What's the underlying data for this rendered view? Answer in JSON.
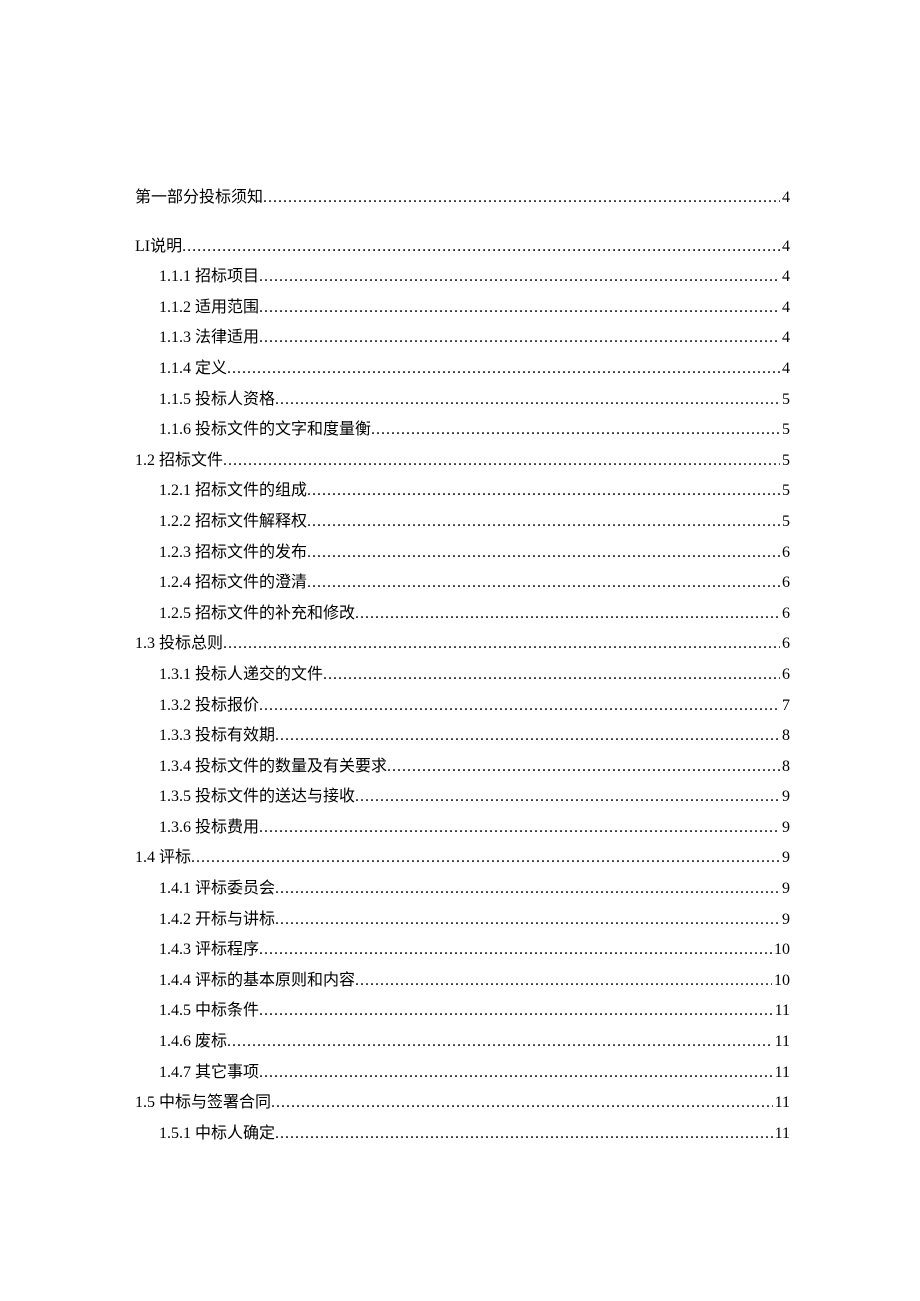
{
  "toc": [
    {
      "indent": 0,
      "title": "第一部分投标须知",
      "page": "4",
      "spacer_after": true
    },
    {
      "indent": 0,
      "title": "LI说明",
      "page": "4"
    },
    {
      "indent": 1,
      "title": "1.1.1 招标项目",
      "page": "4"
    },
    {
      "indent": 1,
      "title": "1.1.2 适用范围",
      "page": "4"
    },
    {
      "indent": 1,
      "title": "1.1.3 法律适用",
      "page": "4"
    },
    {
      "indent": 1,
      "title": "1.1.4 定义",
      "page": "4"
    },
    {
      "indent": 1,
      "title": "1.1.5 投标人资格",
      "page": "5"
    },
    {
      "indent": 1,
      "title": "1.1.6 投标文件的文字和度量衡",
      "page": "5"
    },
    {
      "indent": 0,
      "title": "1.2 招标文件",
      "page": "5"
    },
    {
      "indent": 1,
      "title": "1.2.1 招标文件的组成",
      "page": "5"
    },
    {
      "indent": 1,
      "title": "1.2.2 招标文件解释权",
      "page": "5"
    },
    {
      "indent": 1,
      "title": "1.2.3 招标文件的发布",
      "page": "6"
    },
    {
      "indent": 1,
      "title": "1.2.4 招标文件的澄清",
      "page": "6"
    },
    {
      "indent": 1,
      "title": "1.2.5 招标文件的补充和修改",
      "page": "6"
    },
    {
      "indent": 0,
      "title": "1.3 投标总则",
      "page": "6"
    },
    {
      "indent": 1,
      "title": "1.3.1 投标人递交的文件",
      "page": "6"
    },
    {
      "indent": 1,
      "title": "1.3.2 投标报价",
      "page": "7"
    },
    {
      "indent": 1,
      "title": "1.3.3 投标有效期",
      "page": "8"
    },
    {
      "indent": 1,
      "title": "1.3.4 投标文件的数量及有关要求",
      "page": "8"
    },
    {
      "indent": 1,
      "title": "1.3.5 投标文件的送达与接收",
      "page": "9"
    },
    {
      "indent": 1,
      "title": "1.3.6 投标费用",
      "page": "9"
    },
    {
      "indent": 0,
      "title": "1.4 评标",
      "page": "9"
    },
    {
      "indent": 1,
      "title": "1.4.1 评标委员会",
      "page": "9"
    },
    {
      "indent": 1,
      "title": "1.4.2 开标与讲标",
      "page": "9"
    },
    {
      "indent": 1,
      "title": "1.4.3 评标程序",
      "page": "10"
    },
    {
      "indent": 1,
      "title": "1.4.4 评标的基本原则和内容",
      "page": "10"
    },
    {
      "indent": 1,
      "title": "1.4.5 中标条件",
      "page": "11"
    },
    {
      "indent": 1,
      "title": "1.4.6 废标",
      "page": "11"
    },
    {
      "indent": 1,
      "title": "1.4.7 其它事项",
      "page": "11"
    },
    {
      "indent": 0,
      "title": "1.5 中标与签署合同",
      "page": "11"
    },
    {
      "indent": 1,
      "title": "1.5.1 中标人确定",
      "page": "11"
    }
  ]
}
